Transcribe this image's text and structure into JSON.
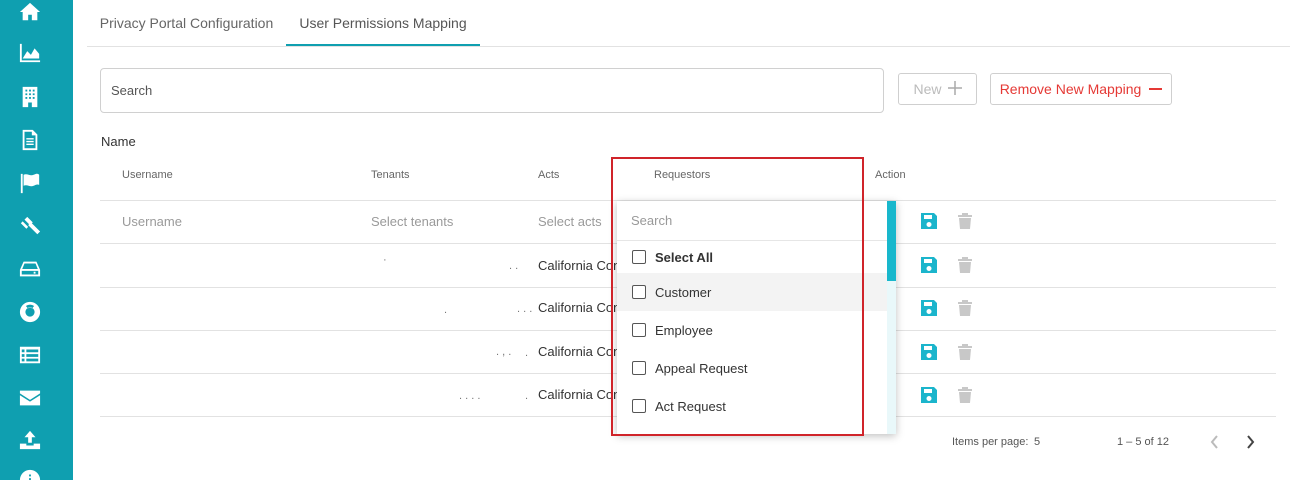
{
  "sidebar": {
    "icons": [
      "home-icon",
      "area-chart-icon",
      "building-icon",
      "document-icon",
      "flag-icon",
      "gavel-icon",
      "hard-drive-icon",
      "life-ring-icon",
      "list-icon",
      "envelope-icon",
      "upload-icon",
      "info-icon"
    ]
  },
  "tabs": [
    {
      "label": "Privacy Portal Configuration",
      "active": false
    },
    {
      "label": "User Permissions Mapping",
      "active": true
    }
  ],
  "toolbar": {
    "search_placeholder": "Search",
    "new_label": "New",
    "remove_label": "Remove New Mapping"
  },
  "section": {
    "name_label": "Name"
  },
  "table": {
    "headers": {
      "username": "Username",
      "tenants": "Tenants",
      "acts": "Acts",
      "requestors": "Requestors",
      "action": "Action"
    },
    "new_row": {
      "username_placeholder": "Username",
      "tenants_placeholder": "Select tenants",
      "acts_placeholder": "Select acts"
    },
    "rows": [
      {
        "tenants": "·",
        "acts_dots": ". .",
        "acts": "California Con"
      },
      {
        "tenants": ".",
        "acts_dots": ". . .",
        "acts": "California Con"
      },
      {
        "tenants": ". ,  .",
        "acts_dots": ".",
        "acts": "California Con"
      },
      {
        "tenants": ". . . .",
        "acts_dots": ".",
        "acts": "California Con"
      }
    ]
  },
  "requestors_dropdown": {
    "search_placeholder": "Search",
    "select_all": "Select All",
    "options": [
      "Customer",
      "Employee",
      "Appeal Request",
      "Act Request"
    ],
    "hovered": "Customer"
  },
  "paginator": {
    "items_per_page_label": "Items per page:",
    "items_per_page_value": "5",
    "range": "1 – 5 of 12"
  },
  "colors": {
    "accent": "#0f9fb0",
    "danger": "#e53935",
    "highlight": "#d0242a"
  }
}
